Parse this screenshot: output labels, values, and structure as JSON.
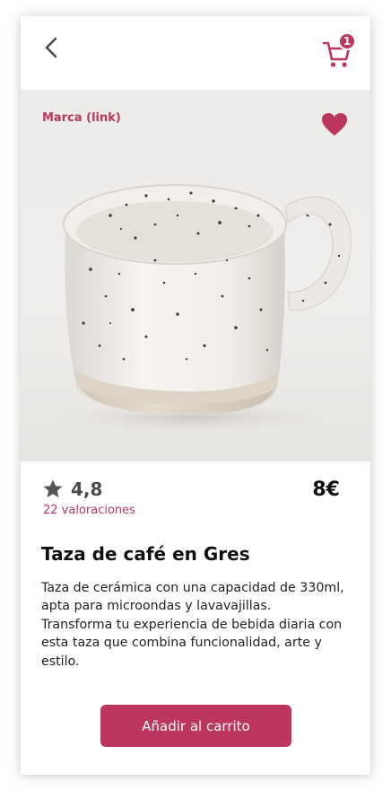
{
  "colors": {
    "accent": "#bd365e",
    "text": "#111111"
  },
  "header": {
    "back_icon": "chevron-left-icon",
    "cart_icon": "cart-icon",
    "cart_count": "1"
  },
  "product": {
    "brand": "Marca (link)",
    "favorite_icon": "heart-icon",
    "rating": "4,8",
    "reviews": "22 valoraciones",
    "price": "8€",
    "name": "Taza de café en Gres",
    "description": "Taza de cerámica con una capacidad de 330ml, apta para microondas y lavavajillas. Transforma tu experiencia de bebida diaria con esta taza  que combina funcionalidad, arte y estilo."
  },
  "actions": {
    "add_to_cart": "Añadir al carrito"
  }
}
